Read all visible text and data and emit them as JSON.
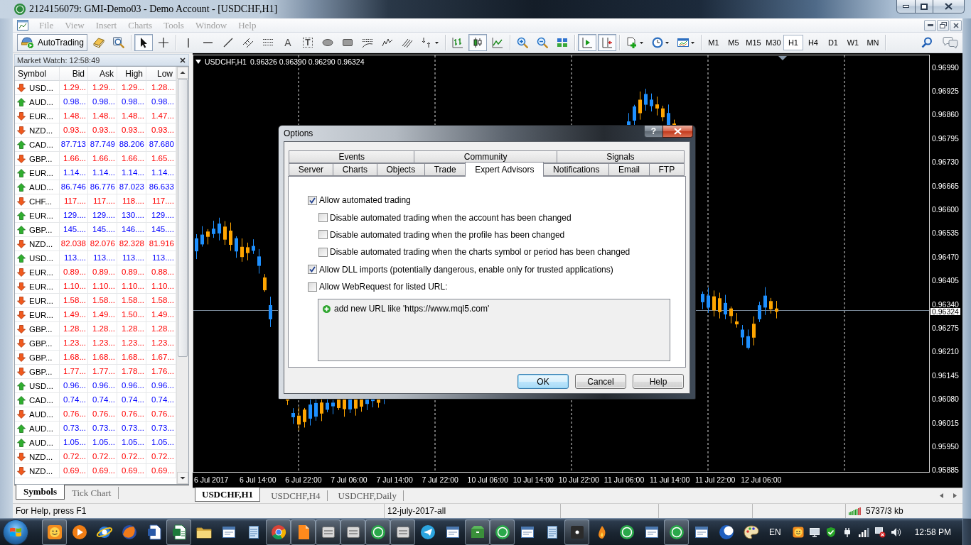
{
  "window": {
    "title": "2124156079: GMI-Demo03 - Demo Account - [USDCHF,H1]"
  },
  "menu": [
    {
      "label": "File",
      "disabled": true
    },
    {
      "label": "View",
      "disabled": true
    },
    {
      "label": "Insert",
      "disabled": true
    },
    {
      "label": "Charts",
      "disabled": true
    },
    {
      "label": "Tools",
      "disabled": true
    },
    {
      "label": "Window",
      "disabled": true
    },
    {
      "label": "Help",
      "disabled": true
    }
  ],
  "toolbar": {
    "auto_trading": {
      "label": "AutoTrading",
      "on": true
    },
    "tool_groups": [
      [
        {
          "kind": "book",
          "pressed": false
        },
        {
          "kind": "tester",
          "pressed": false
        }
      ],
      [
        {
          "kind": "cursor",
          "pressed": true
        },
        {
          "kind": "crosshair",
          "pressed": false
        }
      ],
      [
        {
          "kind": "vline",
          "pressed": false
        },
        {
          "kind": "hline",
          "pressed": false
        },
        {
          "kind": "trendline",
          "pressed": false
        },
        {
          "kind": "channel",
          "pressed": false
        },
        {
          "kind": "fibo",
          "pressed": false
        },
        {
          "kind": "text",
          "glyph": "A",
          "pressed": false
        },
        {
          "kind": "label",
          "glyph": "T",
          "pressed": false
        },
        {
          "kind": "ellipse",
          "pressed": false
        },
        {
          "kind": "rectangle",
          "pressed": false
        },
        {
          "kind": "fibo_fan",
          "pressed": false
        },
        {
          "kind": "waves",
          "pressed": false
        },
        {
          "kind": "slashes",
          "pressed": false
        },
        {
          "kind": "arrows",
          "pressed": false
        }
      ],
      [
        {
          "kind": "bar_chart",
          "pressed": false
        },
        {
          "kind": "candle_chart",
          "pressed": true
        },
        {
          "kind": "line_chart",
          "pressed": false
        }
      ],
      [
        {
          "kind": "zoom_in",
          "pressed": false
        },
        {
          "kind": "zoom_out",
          "pressed": false
        },
        {
          "kind": "tile",
          "pressed": false
        }
      ],
      [
        {
          "kind": "autoscroll",
          "pressed": true
        },
        {
          "kind": "shift",
          "pressed": true
        }
      ],
      [
        {
          "kind": "indicators",
          "pressed": false
        },
        {
          "kind": "periods",
          "pressed": false
        },
        {
          "kind": "templates",
          "pressed": false
        }
      ]
    ],
    "timeframes": [
      {
        "label": "M1",
        "selected": false
      },
      {
        "label": "M5",
        "selected": false
      },
      {
        "label": "M15",
        "selected": false
      },
      {
        "label": "M30",
        "selected": false
      },
      {
        "label": "H1",
        "selected": true
      },
      {
        "label": "H4",
        "selected": false
      },
      {
        "label": "D1",
        "selected": false
      },
      {
        "label": "W1",
        "selected": false
      },
      {
        "label": "MN",
        "selected": false
      }
    ]
  },
  "market_watch": {
    "title": "Market Watch: 12:58:49",
    "columns": [
      "Symbol",
      "Bid",
      "Ask",
      "High",
      "Low"
    ],
    "rows": [
      {
        "symbol": "USD...",
        "rising": false,
        "bid": "1.29...",
        "ask": "1.29...",
        "high": "1.29...",
        "low": "1.28..."
      },
      {
        "symbol": "AUD...",
        "rising": true,
        "bid": "0.98...",
        "ask": "0.98...",
        "high": "0.98...",
        "low": "0.98..."
      },
      {
        "symbol": "EUR...",
        "rising": false,
        "bid": "1.48...",
        "ask": "1.48...",
        "high": "1.48...",
        "low": "1.47..."
      },
      {
        "symbol": "NZD...",
        "rising": false,
        "bid": "0.93...",
        "ask": "0.93...",
        "high": "0.93...",
        "low": "0.93..."
      },
      {
        "symbol": "CAD...",
        "rising": true,
        "bid": "87.713",
        "ask": "87.749",
        "high": "88.206",
        "low": "87.680"
      },
      {
        "symbol": "GBP...",
        "rising": false,
        "bid": "1.66...",
        "ask": "1.66...",
        "high": "1.66...",
        "low": "1.65..."
      },
      {
        "symbol": "EUR...",
        "rising": true,
        "bid": "1.14...",
        "ask": "1.14...",
        "high": "1.14...",
        "low": "1.14..."
      },
      {
        "symbol": "AUD...",
        "rising": true,
        "bid": "86.746",
        "ask": "86.776",
        "high": "87.023",
        "low": "86.633"
      },
      {
        "symbol": "CHF...",
        "rising": false,
        "bid": "117....",
        "ask": "117....",
        "high": "118....",
        "low": "117...."
      },
      {
        "symbol": "EUR...",
        "rising": true,
        "bid": "129....",
        "ask": "129....",
        "high": "130....",
        "low": "129...."
      },
      {
        "symbol": "GBP...",
        "rising": true,
        "bid": "145....",
        "ask": "145....",
        "high": "146....",
        "low": "145...."
      },
      {
        "symbol": "NZD...",
        "rising": false,
        "bid": "82.038",
        "ask": "82.076",
        "high": "82.328",
        "low": "81.916"
      },
      {
        "symbol": "USD...",
        "rising": true,
        "bid": "113....",
        "ask": "113....",
        "high": "113....",
        "low": "113...."
      },
      {
        "symbol": "EUR...",
        "rising": false,
        "bid": "0.89...",
        "ask": "0.89...",
        "high": "0.89...",
        "low": "0.88..."
      },
      {
        "symbol": "EUR...",
        "rising": false,
        "bid": "1.10...",
        "ask": "1.10...",
        "high": "1.10...",
        "low": "1.10..."
      },
      {
        "symbol": "EUR...",
        "rising": false,
        "bid": "1.58...",
        "ask": "1.58...",
        "high": "1.58...",
        "low": "1.58..."
      },
      {
        "symbol": "EUR...",
        "rising": false,
        "bid": "1.49...",
        "ask": "1.49...",
        "high": "1.50...",
        "low": "1.49..."
      },
      {
        "symbol": "GBP...",
        "rising": false,
        "bid": "1.28...",
        "ask": "1.28...",
        "high": "1.28...",
        "low": "1.28..."
      },
      {
        "symbol": "GBP...",
        "rising": false,
        "bid": "1.23...",
        "ask": "1.23...",
        "high": "1.23...",
        "low": "1.23..."
      },
      {
        "symbol": "GBP...",
        "rising": false,
        "bid": "1.68...",
        "ask": "1.68...",
        "high": "1.68...",
        "low": "1.67..."
      },
      {
        "symbol": "GBP...",
        "rising": false,
        "bid": "1.77...",
        "ask": "1.77...",
        "high": "1.78...",
        "low": "1.76..."
      },
      {
        "symbol": "USD...",
        "rising": true,
        "bid": "0.96...",
        "ask": "0.96...",
        "high": "0.96...",
        "low": "0.96..."
      },
      {
        "symbol": "CAD...",
        "rising": true,
        "bid": "0.74...",
        "ask": "0.74...",
        "high": "0.74...",
        "low": "0.74..."
      },
      {
        "symbol": "AUD...",
        "rising": false,
        "bid": "0.76...",
        "ask": "0.76...",
        "high": "0.76...",
        "low": "0.76..."
      },
      {
        "symbol": "AUD...",
        "rising": true,
        "bid": "0.73...",
        "ask": "0.73...",
        "high": "0.73...",
        "low": "0.73..."
      },
      {
        "symbol": "AUD...",
        "rising": true,
        "bid": "1.05...",
        "ask": "1.05...",
        "high": "1.05...",
        "low": "1.05..."
      },
      {
        "symbol": "NZD...",
        "rising": false,
        "bid": "0.72...",
        "ask": "0.72...",
        "high": "0.72...",
        "low": "0.72..."
      },
      {
        "symbol": "NZD...",
        "rising": false,
        "bid": "0.69...",
        "ask": "0.69...",
        "high": "0.69...",
        "low": "0.69..."
      }
    ],
    "tabs": [
      {
        "label": "Symbols",
        "selected": true
      },
      {
        "label": "Tick Chart",
        "selected": false
      }
    ]
  },
  "chart": {
    "symbol": "USDCHF,H1",
    "quote": "0.96326 0.96390 0.96290 0.96324",
    "price_ticks": [
      "0.96990",
      "0.96925",
      "0.96860",
      "0.96795",
      "0.96730",
      "0.96665",
      "0.96600",
      "0.96535",
      "0.96470",
      "0.96405",
      "0.96340",
      "0.96275",
      "0.96210",
      "0.96145",
      "0.96080",
      "0.96015",
      "0.95950",
      "0.95885"
    ],
    "current_price": "0.96324",
    "time_labels": [
      "6 Jul 2017",
      "6 Jul 14:00",
      "6 Jul 22:00",
      "7 Jul 06:00",
      "7 Jul 14:00",
      "7 Jul 22:00",
      "10 Jul 06:00",
      "10 Jul 14:00",
      "10 Jul 22:00",
      "11 Jul 06:00",
      "11 Jul 14:00",
      "11 Jul 22:00",
      "12 Jul 06:00"
    ]
  },
  "chart_tabs": [
    {
      "label": "USDCHF,H1",
      "selected": true
    },
    {
      "label": "USDCHF,H4",
      "selected": false
    },
    {
      "label": "USDCHF,Daily",
      "selected": false
    }
  ],
  "status_bar": {
    "help_text": "For Help, press F1",
    "profile": "12-july-2017-all",
    "traffic": "5737/3 kb"
  },
  "taskbar": {
    "apps": [
      {
        "kind": "face",
        "open": true
      },
      {
        "kind": "play",
        "open": false
      },
      {
        "kind": "ring",
        "open": false
      },
      {
        "kind": "globe",
        "open": false
      },
      {
        "kind": "page",
        "open": false
      },
      {
        "kind": "sheet",
        "open": true
      },
      {
        "kind": "folder",
        "open": false
      },
      {
        "kind": "window",
        "open": false
      },
      {
        "kind": "notepad",
        "open": false
      },
      {
        "kind": "wheel",
        "open": true
      },
      {
        "kind": "folded",
        "open": true
      },
      {
        "kind": "tile",
        "open": true
      },
      {
        "kind": "tile",
        "open": true
      },
      {
        "kind": "disc",
        "open": true
      },
      {
        "kind": "tile",
        "open": true
      },
      {
        "kind": "plane",
        "open": false
      },
      {
        "kind": "window",
        "open": false
      },
      {
        "kind": "box",
        "open": true
      },
      {
        "kind": "disc",
        "open": true
      },
      {
        "kind": "window",
        "open": false
      },
      {
        "kind": "notepad",
        "open": false
      },
      {
        "kind": "dot",
        "open": true
      },
      {
        "kind": "flame",
        "open": false
      },
      {
        "kind": "disc",
        "open": false
      },
      {
        "kind": "window",
        "open": false
      },
      {
        "kind": "disc",
        "open": true
      },
      {
        "kind": "window",
        "open": false
      },
      {
        "kind": "moon",
        "open": false
      },
      {
        "kind": "palette",
        "open": false
      }
    ],
    "language": "EN",
    "clock": "12:58 PM"
  },
  "dialog": {
    "title": "Options",
    "help_glyph": "?",
    "tab_rows": [
      [
        {
          "label": "Events",
          "selected": false
        },
        {
          "label": "Community",
          "selected": false
        },
        {
          "label": "Signals",
          "selected": false
        }
      ],
      [
        {
          "label": "Server",
          "selected": false
        },
        {
          "label": "Charts",
          "selected": false
        },
        {
          "label": "Objects",
          "selected": false
        },
        {
          "label": "Trade",
          "selected": false
        },
        {
          "label": "Expert Advisors",
          "selected": true
        },
        {
          "label": "Notifications",
          "selected": false
        },
        {
          "label": "Email",
          "selected": false
        },
        {
          "label": "FTP",
          "selected": false
        }
      ]
    ],
    "options": [
      {
        "label": "Allow automated trading",
        "checked": true,
        "children": [
          {
            "label": "Disable automated trading when the account has been changed",
            "checked": false
          },
          {
            "label": "Disable automated trading when the profile has been changed",
            "checked": false
          },
          {
            "label": "Disable automated trading when the charts symbol or period has been changed",
            "checked": false
          }
        ]
      },
      {
        "label": "Allow DLL imports (potentially dangerous, enable only for trusted applications)",
        "checked": true
      },
      {
        "label": "Allow WebRequest for listed URL:",
        "checked": false
      }
    ],
    "url_list": {
      "disabled": true,
      "items": [
        {
          "label": "add new URL like 'https://www.mql5.com'"
        }
      ]
    },
    "buttons": [
      {
        "label": "OK",
        "default": true
      },
      {
        "label": "Cancel",
        "default": false
      },
      {
        "label": "Help",
        "default": false
      }
    ]
  }
}
